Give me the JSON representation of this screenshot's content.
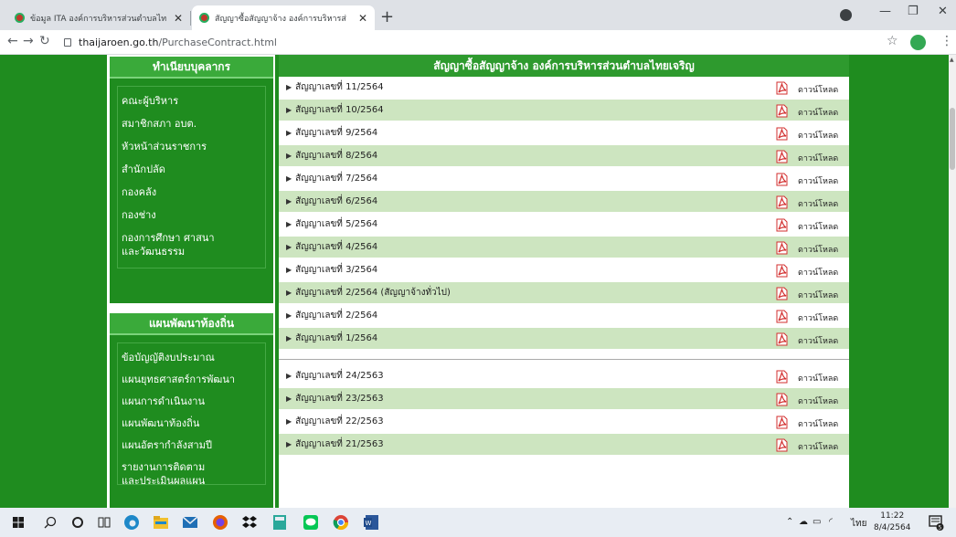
{
  "browser": {
    "tabs": [
      {
        "title": "ข้อมูล ITA องค์การบริหารส่วนตำบลไท"
      },
      {
        "title": "สัญญาซื้อสัญญาจ้าง องค์การบริหารส่"
      }
    ],
    "url_host": "thaijaroen.go.th",
    "url_path": "/PurchaseContract.html"
  },
  "sidebar": {
    "section1_title": "ทำเนียบบุคลากร",
    "section1_items": [
      "คณะผู้บริหาร",
      "สมาชิกสภา อบต.",
      "หัวหน้าส่วนราชการ",
      "สำนักปลัด",
      "กองคลัง",
      "กองช่าง",
      "กองการศึกษา ศาสนา\nและวัฒนธรรม"
    ],
    "section2_title": "แผนพัฒนาท้องถิ่น",
    "section2_items": [
      "ข้อบัญญัติงบประมาณ",
      "แผนยุทธศาสตร์การพัฒนา",
      "แผนการดำเนินงาน",
      "แผนพัฒนาท้องถิ่น",
      "แผนอัตรากำลังสามปี",
      "รายงานการติดตาม\nและประเมินผลแผน"
    ]
  },
  "content": {
    "title": "สัญญาซื้อสัญญาจ้าง องค์การบริหารส่วนตำบลไทยเจริญ",
    "download_label": "ดาวน์โหลด",
    "group1": [
      "สัญญาเลขที่ 11/2564",
      "สัญญาเลขที่ 10/2564",
      "สัญญาเลขที่ 9/2564",
      "สัญญาเลขที่ 8/2564",
      "สัญญาเลขที่ 7/2564",
      "สัญญาเลขที่ 6/2564",
      "สัญญาเลขที่ 5/2564",
      "สัญญาเลขที่ 4/2564",
      "สัญญาเลขที่ 3/2564",
      "สัญญาเลขที่ 2/2564 (สัญญาจ้างทั่วไป)",
      "สัญญาเลขที่ 2/2564",
      "สัญญาเลขที่ 1/2564"
    ],
    "group2": [
      "สัญญาเลขที่ 24/2563",
      "สัญญาเลขที่ 23/2563",
      "สัญญาเลขที่ 22/2563",
      "สัญญาเลขที่ 21/2563"
    ]
  },
  "taskbar": {
    "tray_lang": "ไทย",
    "time": "11:22",
    "date": "8/4/2564",
    "notification_count": "5"
  }
}
